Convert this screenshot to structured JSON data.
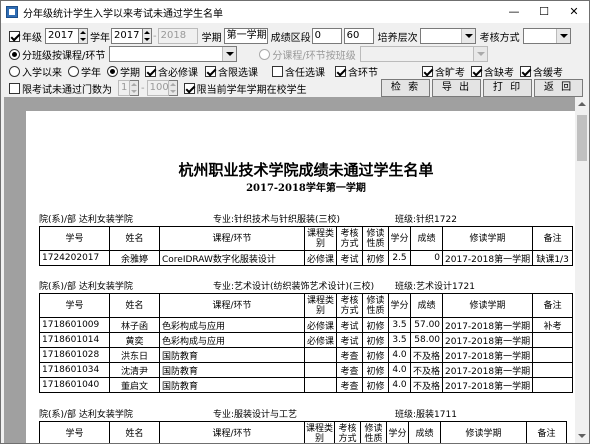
{
  "window": {
    "title": "分年级统计学生入学以来考试未通过学生名单"
  },
  "filters": {
    "grade_label": "年级",
    "grade_from": "2017",
    "grade_to": "2017",
    "year_label": "学年",
    "year_from": "2017",
    "year_to": "2018",
    "term_label": "学期",
    "term_value": "第一学期",
    "score_range_label": "成绩区段",
    "score_min": "0",
    "score_max": "60",
    "level_label": "培养层次",
    "level_value": "",
    "exam_type_label": "考核方式",
    "exam_type_value": "",
    "by_class_label": "分班级按课程/环节",
    "by_class_value": "",
    "by_course_label": "分课程/环节按班级",
    "by_course_value": "",
    "since_enroll_label": "入学以来",
    "school_year_label": "学年",
    "semester_label": "学期",
    "required_label": "含必修课",
    "limited_label": "含限选课",
    "elective_label": "含任选课",
    "practice_label": "含环节",
    "absent_label": "含旷考",
    "missing_label": "含缺考",
    "deferred_label": "含缓考",
    "limit_fail_label": "限考试未通过门数为",
    "limit_from": "1",
    "limit_to": "100",
    "current_only_label": "限当前学年学期在校学生"
  },
  "buttons": {
    "search": "检 索",
    "export": "导 出",
    "print": "打 印",
    "back": "返 回"
  },
  "report": {
    "title": "杭州职业技术学院成绩未通过学生名单",
    "subtitle": "2017-2018学年第一学期",
    "columns": [
      "学号",
      "姓名",
      "课程/环节",
      "课程类别",
      "考核方式",
      "修读性质",
      "学分",
      "成绩",
      "修读学期",
      "备注"
    ],
    "sections": [
      {
        "dept": "院(系)/部 达利女装学院",
        "major": "专业:针织技术与针织服装(三校)",
        "klass": "班级:针织1722",
        "rows": [
          [
            "1724202017",
            "余雅婷",
            "CoreIDRAW数字化服装设计",
            "必修课",
            "考试",
            "初修",
            "2.5",
            "0",
            "2017-2018第一学期",
            "缺课1/3"
          ]
        ]
      },
      {
        "dept": "院(系)/部 达利女装学院",
        "major": "专业:艺术设计(纺织装饰艺术设计)(三校)",
        "klass": "班级:艺术设计1721",
        "rows": [
          [
            "1718601009",
            "林子函",
            "色彩构成与应用",
            "必修课",
            "考试",
            "初修",
            "3.5",
            "57.00",
            "2017-2018第一学期",
            "补考"
          ],
          [
            "1718601014",
            "黄奕",
            "色彩构成与应用",
            "必修课",
            "考试",
            "初修",
            "3.5",
            "58.00",
            "2017-2018第一学期",
            ""
          ],
          [
            "1718601028",
            "洪东日",
            "国防教育",
            "",
            "考查",
            "初修",
            "4.0",
            "不及格",
            "2017-2018第一学期",
            ""
          ],
          [
            "1718601034",
            "沈清尹",
            "国防教育",
            "",
            "考查",
            "初修",
            "4.0",
            "不及格",
            "2017-2018第一学期",
            ""
          ],
          [
            "1718601040",
            "董启文",
            "国防教育",
            "",
            "考查",
            "初修",
            "4.0",
            "不及格",
            "2017-2018第一学期",
            ""
          ]
        ]
      },
      {
        "dept": "院(系)/部 达利女装学院",
        "major": "专业:服装设计与工艺",
        "klass": "班级:服装1711",
        "rows": []
      }
    ]
  }
}
